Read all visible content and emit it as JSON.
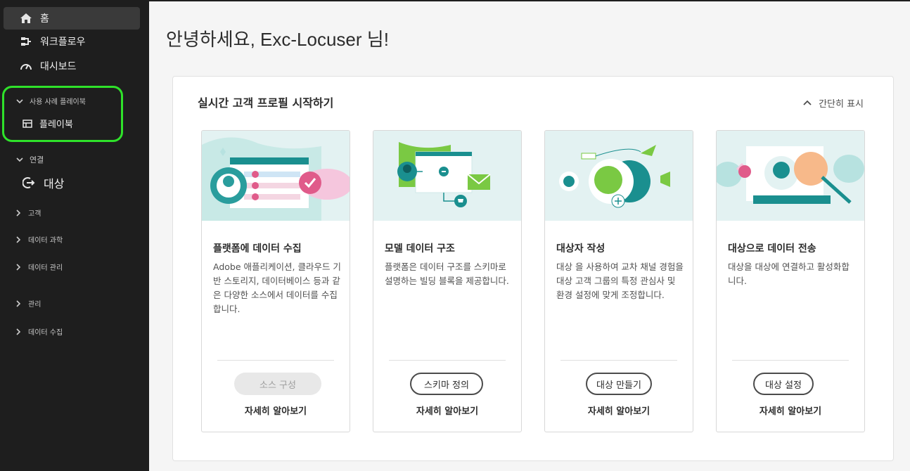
{
  "sidebar": {
    "home": "홈",
    "workflows": "워크플로우",
    "dashboards": "대시보드",
    "use_case_playbooks": "사용 사례 플레이북",
    "playbooks": "플레이북",
    "connections": "연결",
    "destinations": "대상",
    "customer": "고객",
    "data_science": "데이터 과학",
    "data_management": "데이터 관리",
    "administration": "관리",
    "data_collection": "데이터 수집"
  },
  "main": {
    "greeting": "안녕하세요, Exc-Locuser 님!",
    "panel_title": "실시간 고객 프로필 시작하기",
    "collapse_label": "간단히 표시",
    "cards": [
      {
        "title": "플랫폼에 데이터 수집",
        "description": "Adobe 애플리케이션, 클라우드 기반 스토리지, 데이터베이스 등과 같은 다양한 소스에서 데이터를 수집합니다.",
        "button": "소스 구성",
        "learn_more": "자세히 알아보기"
      },
      {
        "title": "모델 데이터 구조",
        "description": "플랫폼은 데이터 구조를 스키마로 설명하는 빌딩 블록을 제공합니다.",
        "button": "스키마 정의",
        "learn_more": "자세히 알아보기"
      },
      {
        "title": "대상자 작성",
        "description": "대상 을 사용하여 교차 채널 경험을 대상 고객 그룹의 특정 관심사 및 환경 설정에 맞게 조정합니다.",
        "button": "대상 만들기",
        "learn_more": "자세히 알아보기"
      },
      {
        "title": "대상으로 데이터 전송",
        "description": "대상을 대상에 연결하고 활성화합니다.",
        "button": "대상 설정",
        "learn_more": "자세히 알아보기"
      }
    ]
  },
  "colors": {
    "sidebar_bg": "#1e1e1e",
    "highlight": "#2fe22a",
    "illustration_bg": "#e3f2f2",
    "teal": "#1a8f8f",
    "green": "#7ac943",
    "pink": "#e05b8a"
  }
}
